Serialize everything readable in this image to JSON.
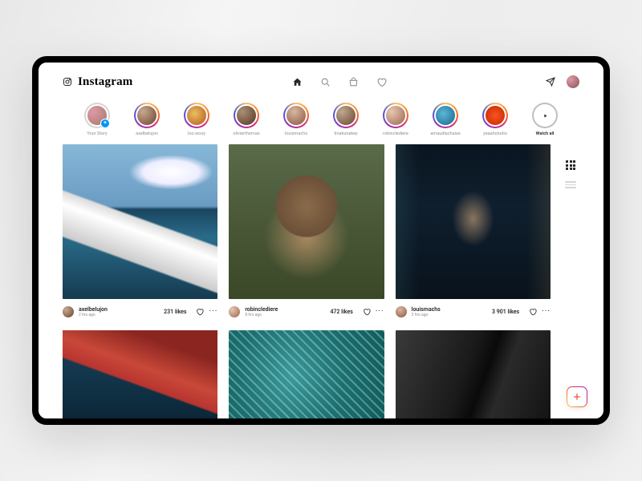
{
  "brand": "Instagram",
  "stories": [
    {
      "label": "Your Story",
      "your": true
    },
    {
      "label": "axelbelujon"
    },
    {
      "label": "loo.wooy"
    },
    {
      "label": "olivierthomas"
    },
    {
      "label": "louismachs"
    },
    {
      "label": "tinakunakey"
    },
    {
      "label": "robinclediere"
    },
    {
      "label": "arnaudlachaise"
    },
    {
      "label": "yeaahstudio"
    }
  ],
  "watch_all": "Watch all",
  "posts": [
    {
      "user": "axelbelujon",
      "time": "2 hrs ago",
      "likes": "231 likes"
    },
    {
      "user": "robinclediere",
      "time": "8 hrs ago",
      "likes": "472 likes"
    },
    {
      "user": "louismachs",
      "time": "3 hrs ago",
      "likes": "3 901 likes"
    }
  ]
}
